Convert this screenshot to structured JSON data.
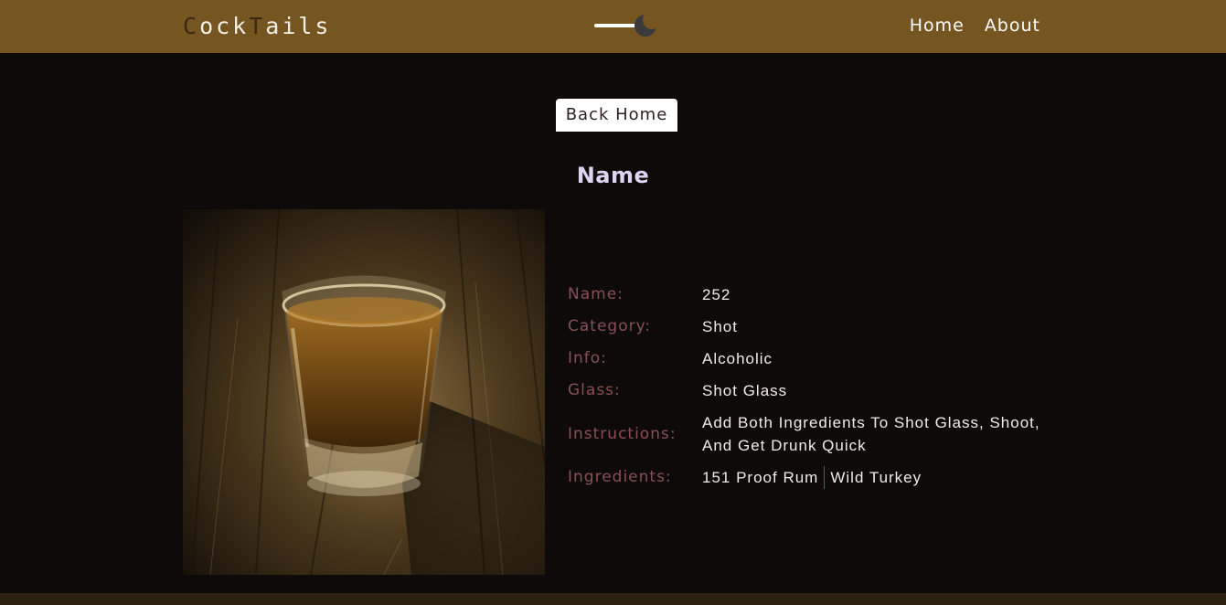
{
  "navbar": {
    "logo_parts": [
      "C",
      "ock",
      "T",
      "ails"
    ],
    "links": [
      "Home",
      "About"
    ],
    "toggle_icon": "moon-icon",
    "background": "#755620"
  },
  "back_button": "Back Home",
  "page_title": "Name",
  "image": {
    "subject": "shot glass of whiskey on wooden table"
  },
  "details": {
    "labels": [
      "Name:",
      "Category:",
      "Info:",
      "Glass:",
      "Instructions:",
      "Ingredients:"
    ],
    "name": "252",
    "category": "Shot",
    "info": "Alcoholic",
    "glass": "Shot Glass",
    "instructions": "Add Both Ingredients To Shot Glass, Shoot, And Get Drunk Quick",
    "ingredients": [
      "151 Proof Rum",
      "Wild Turkey"
    ]
  },
  "colors": {
    "page_background": "#0e0a0a",
    "label_color": "#8a4f55",
    "title_color": "#dcd4f3"
  }
}
